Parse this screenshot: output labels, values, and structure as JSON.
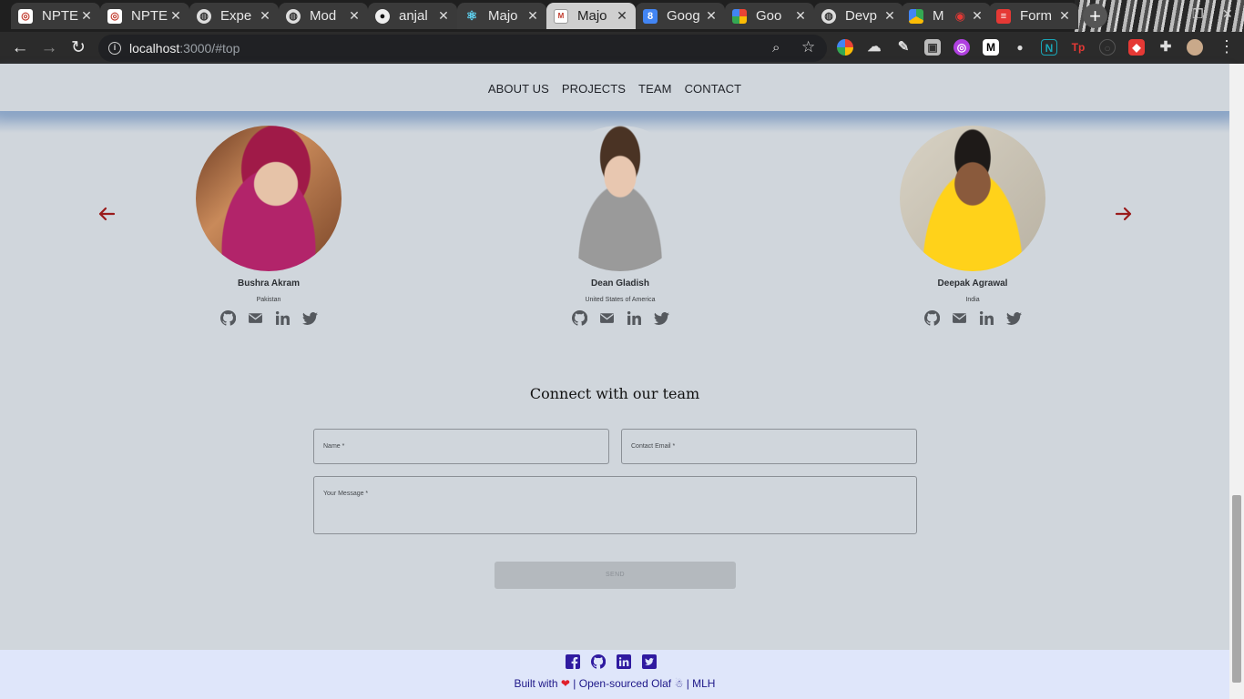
{
  "browser": {
    "tabs": [
      {
        "title": "NPTE",
        "icon": "nptel-icon"
      },
      {
        "title": "NPTE",
        "icon": "nptel-icon"
      },
      {
        "title": "Expe",
        "icon": "globe-icon"
      },
      {
        "title": "Mod",
        "icon": "globe-icon"
      },
      {
        "title": "anjal",
        "icon": "github-icon"
      },
      {
        "title": "Majo",
        "icon": "react-icon"
      },
      {
        "title": "Majo",
        "icon": "mlh-icon"
      },
      {
        "title": "Goog",
        "icon": "google-calendar-icon"
      },
      {
        "title": "Goo",
        "icon": "google-photos-icon"
      },
      {
        "title": "Devp",
        "icon": "globe-icon"
      },
      {
        "title": "M",
        "icon": "google-meet-icon"
      },
      {
        "title": "Form",
        "icon": "forms-icon"
      }
    ],
    "url_host": "localhost",
    "url_path": ":3000/#top"
  },
  "nav": {
    "items": [
      "ABOUT US",
      "PROJECTS",
      "TEAM",
      "CONTACT"
    ]
  },
  "team": [
    {
      "name": "Bushra Akram",
      "country": "Pakistan"
    },
    {
      "name": "Dean Gladish",
      "country": "United States of America"
    },
    {
      "name": "Deepak Agrawal",
      "country": "India"
    }
  ],
  "contact": {
    "heading": "Connect with our team",
    "name_label": "Name *",
    "email_label": "Contact Email *",
    "message_label": "Your Message *",
    "send_label": "SEND"
  },
  "footer": {
    "built_with": "Built with",
    "open_sourced": "| Open-sourced Olaf",
    "mlh": "| MLH"
  },
  "colors": {
    "accent_arrow": "#9a1b1b",
    "footer_text": "#1d1788",
    "footer_bg": "#dfe6fa",
    "page_bg": "#d0d6dc"
  }
}
